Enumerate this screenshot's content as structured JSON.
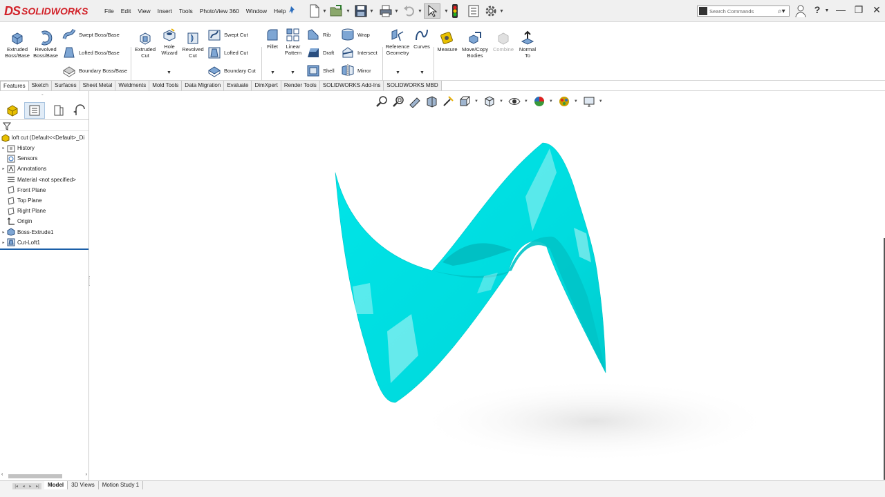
{
  "app": {
    "brand": "SOLIDWORKS",
    "brand_mark": "DS"
  },
  "menu": [
    "File",
    "Edit",
    "View",
    "Insert",
    "Tools",
    "PhotoView 360",
    "Window",
    "Help"
  ],
  "search": {
    "placeholder": "Search Commands"
  },
  "features_toolbar": {
    "extruded_boss": "Extruded\nBoss/Base",
    "revolved_boss": "Revolved\nBoss/Base",
    "swept_boss": "Swept Boss/Base",
    "lofted_boss": "Lofted Boss/Base",
    "boundary_boss": "Boundary Boss/Base",
    "extruded_cut": "Extruded\nCut",
    "hole_wizard": "Hole\nWizard",
    "revolved_cut": "Revolved\nCut",
    "swept_cut": "Swept Cut",
    "lofted_cut": "Lofted Cut",
    "boundary_cut": "Boundary Cut",
    "fillet": "Fillet",
    "linear_pattern": "Linear\nPattern",
    "rib": "Rib",
    "wrap": "Wrap",
    "draft": "Draft",
    "intersect": "Intersect",
    "shell": "Shell",
    "mirror": "Mirror",
    "reference_geometry": "Reference\nGeometry",
    "curves": "Curves",
    "measure": "Measure",
    "move_copy": "Move/Copy\nBodies",
    "combine": "Combine",
    "normal_to": "Normal\nTo"
  },
  "cm_tabs": [
    "Features",
    "Sketch",
    "Surfaces",
    "Sheet Metal",
    "Weldments",
    "Mold Tools",
    "Data Migration",
    "Evaluate",
    "DimXpert",
    "Render Tools",
    "SOLIDWORKS Add-Ins",
    "SOLIDWORKS MBD"
  ],
  "active_cm_tab": "Features",
  "tree": {
    "root": "loft cut  (Default<<Default>_Di",
    "items": [
      {
        "label": "History",
        "expandable": true,
        "icon": "history-folder-icon"
      },
      {
        "label": "Sensors",
        "expandable": false,
        "icon": "sensors-icon"
      },
      {
        "label": "Annotations",
        "expandable": true,
        "icon": "annotations-icon"
      },
      {
        "label": "Material <not specified>",
        "expandable": false,
        "icon": "material-icon"
      },
      {
        "label": "Front Plane",
        "expandable": false,
        "icon": "plane-icon"
      },
      {
        "label": "Top Plane",
        "expandable": false,
        "icon": "plane-icon"
      },
      {
        "label": "Right Plane",
        "expandable": false,
        "icon": "plane-icon"
      },
      {
        "label": "Origin",
        "expandable": false,
        "icon": "origin-icon"
      },
      {
        "label": "Boss-Extrude1",
        "expandable": true,
        "icon": "boss-extrude-icon"
      },
      {
        "label": "Cut-Loft1",
        "expandable": true,
        "icon": "cut-loft-icon"
      }
    ]
  },
  "bottom_tabs": [
    "Model",
    "3D Views",
    "Motion Study 1"
  ],
  "active_bottom_tab": "Model",
  "colors": {
    "part_body": "#00e5e8",
    "brand_red": "#d2232a",
    "rollback_bar": "#1b5fa8",
    "icon_blue": "#2b6dbd"
  }
}
